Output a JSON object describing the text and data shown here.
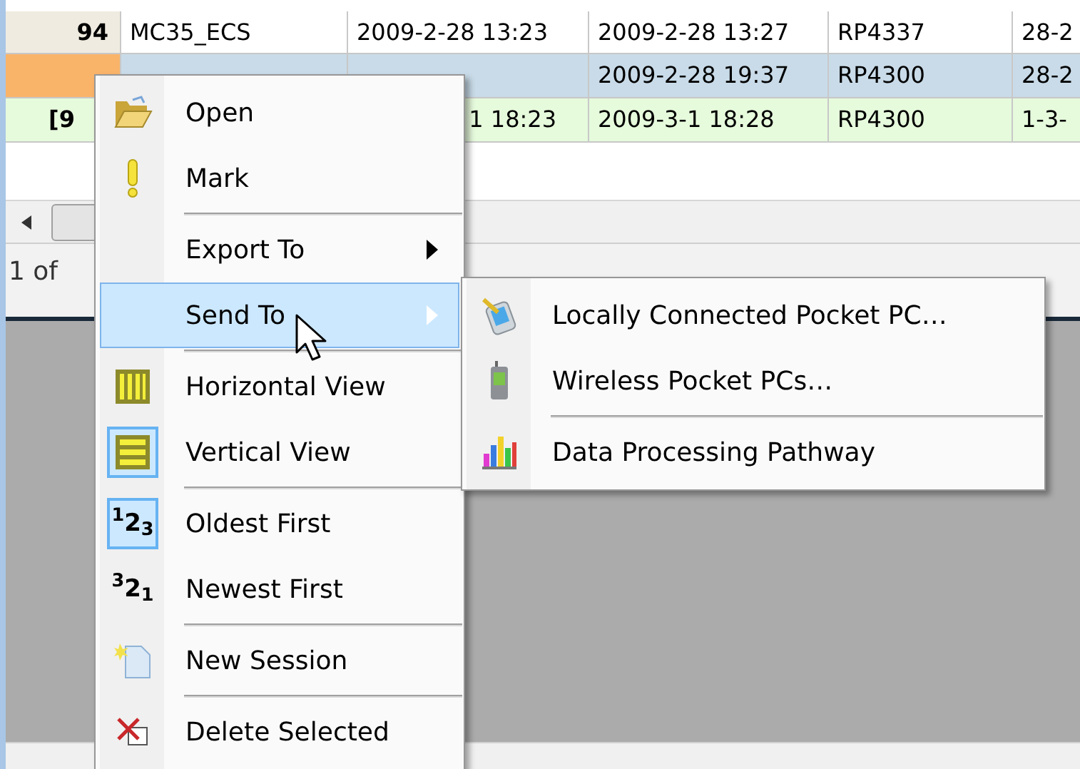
{
  "table": {
    "rows": [
      {
        "selected": false,
        "kind": "plain",
        "cells": [
          {
            "text": "94",
            "cut": false
          },
          {
            "text": "MC35_ECS",
            "cut": false
          },
          {
            "text": "2009-2-28 13:23",
            "cut": false
          },
          {
            "text": "2009-2-28 13:27",
            "cut": false
          },
          {
            "text": "RP4337",
            "cut": false
          },
          {
            "text": "28-2",
            "cut": false
          }
        ]
      },
      {
        "selected": true,
        "kind": "plain",
        "cells": [
          {},
          {},
          {},
          {
            "text": "2009-2-28 19:37",
            "cut": false
          },
          {
            "text": "RP4300",
            "cut": false
          },
          {
            "text": "28-2",
            "cut": false
          }
        ]
      },
      {
        "selected": false,
        "kind": "new",
        "cells": [
          {
            "text": "[9",
            "cut": true
          },
          {},
          {
            "text": "1 18:23",
            "cut": true
          },
          {
            "text": "2009-3-1 18:28",
            "cut": false
          },
          {
            "text": "RP4300",
            "cut": false
          },
          {
            "text": "1-3-",
            "cut": false
          }
        ]
      }
    ]
  },
  "status_bar": {
    "text": "1 of"
  },
  "context_menu": {
    "items": [
      {
        "kind": "item",
        "label": "Open",
        "checked": false,
        "submenu": false,
        "selected": false
      },
      {
        "kind": "item",
        "label": "Mark",
        "checked": false,
        "submenu": false,
        "selected": false
      },
      {
        "kind": "separator"
      },
      {
        "kind": "item",
        "label": "Export To",
        "checked": false,
        "submenu": true,
        "selected": false
      },
      {
        "kind": "item",
        "label": "Send To",
        "checked": false,
        "submenu": true,
        "selected": true
      },
      {
        "kind": "separator"
      },
      {
        "kind": "item",
        "label": "Horizontal View",
        "checked": false,
        "submenu": false,
        "selected": false
      },
      {
        "kind": "item",
        "label": "Vertical View",
        "checked": true,
        "submenu": false,
        "selected": false
      },
      {
        "kind": "separator"
      },
      {
        "kind": "item",
        "label": "Oldest First",
        "icon_text": "$^{1}$2$_{3}$",
        "checked": true,
        "submenu": false,
        "selected": false
      },
      {
        "kind": "item",
        "label": "Newest First",
        "icon_text": "$^{3}$2$_{1}$",
        "checked": false,
        "submenu": false,
        "selected": false
      },
      {
        "kind": "separator"
      },
      {
        "kind": "item",
        "label": "New Session",
        "checked": false,
        "submenu": false,
        "selected": false
      },
      {
        "kind": "separator"
      },
      {
        "kind": "item",
        "label": "Delete Selected",
        "checked": false,
        "submenu": false,
        "selected": false
      }
    ]
  },
  "submenu": {
    "items": [
      {
        "kind": "item",
        "label": "Locally Connected Pocket PC…",
        "selected": false
      },
      {
        "kind": "item",
        "label": "Wireless Pocket PCs…",
        "selected": false
      },
      {
        "kind": "separator"
      },
      {
        "kind": "item",
        "label": "Data Processing Pathway",
        "selected": false
      }
    ]
  }
}
